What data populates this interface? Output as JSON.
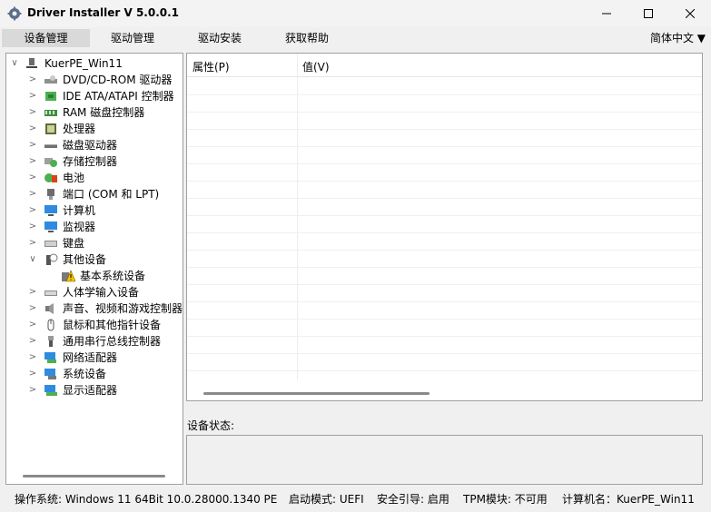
{
  "window": {
    "title": "Driver Installer V 5.0.0.1"
  },
  "menu": {
    "items": [
      "设备管理",
      "驱动管理",
      "驱动安装",
      "获取帮助"
    ],
    "language": "简体中文 ▼"
  },
  "tree": {
    "root": "KuerPE_Win11",
    "items": [
      "DVD/CD-ROM 驱动器",
      "IDE ATA/ATAPI 控制器",
      "RAM 磁盘控制器",
      "处理器",
      "磁盘驱动器",
      "存储控制器",
      "电池",
      "端口 (COM 和 LPT)",
      "计算机",
      "监视器",
      "键盘",
      "其他设备",
      "基本系统设备",
      "人体学输入设备",
      "声音、视频和游戏控制器",
      "鼠标和其他指针设备",
      "通用串行总线控制器",
      "网络适配器",
      "系统设备",
      "显示适配器"
    ]
  },
  "properties": {
    "col_property": "属性(P)",
    "col_value": "值(V)"
  },
  "status": {
    "label": "设备状态:",
    "text": ""
  },
  "statusbar": {
    "os": "操作系统: Windows 11   64Bit   10.0.28000.1340   PE",
    "boot": "启动模式: UEFI",
    "secure_boot": "安全引导: 启用",
    "tpm": "TPM模块: 不可用",
    "computer_name": "计算机名：KuerPE_Win11"
  },
  "icons": {
    "app": "gear-icon",
    "minimize": "minimize-icon",
    "maximize": "maximize-icon",
    "close": "close-icon",
    "warning": "warning-icon"
  },
  "colors": {
    "warning": "#f5c400",
    "accent": "#2e8be0",
    "active_menu": "#d9d9d9"
  }
}
